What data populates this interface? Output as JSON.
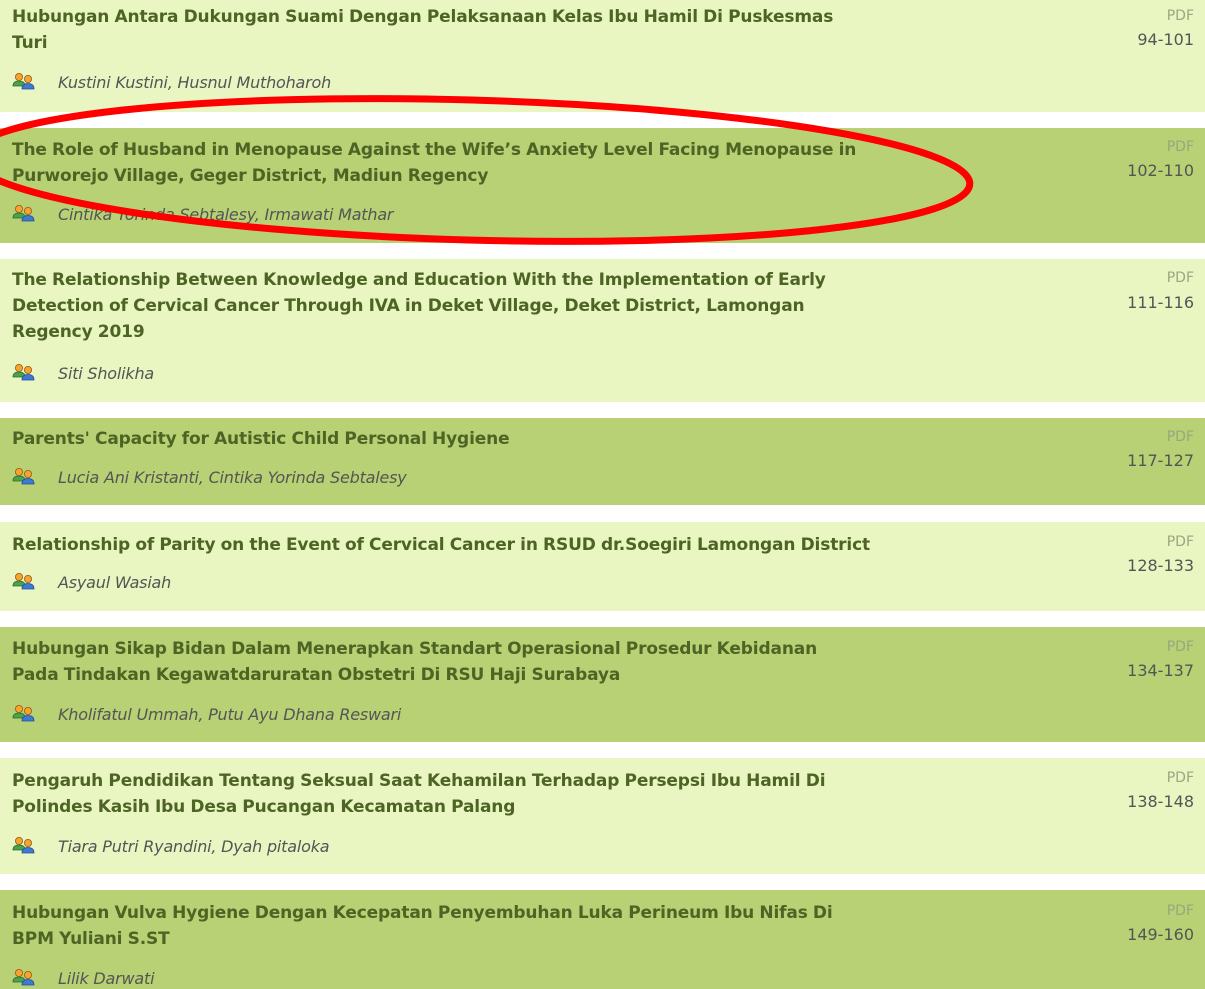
{
  "articles": [
    {
      "title_lines": [
        "Hubungan Antara Dukungan Suami Dengan Pelaksanaan Kelas Ibu Hamil Di Puskesmas",
        "Turi"
      ],
      "authors": "Kustini Kustini, Husnul Muthoharoh",
      "galley": "PDF",
      "pages": "94-101",
      "style": "light"
    },
    {
      "title_lines": [
        "The Role of Husband in Menopause Against the Wife’s Anxiety Level Facing Menopause in",
        "Purworejo Village, Geger District, Madiun Regency"
      ],
      "authors": "Cintika Yorinda Sebtalesy, Irmawati Mathar",
      "galley": "PDF",
      "pages": "102-110",
      "style": "dark"
    },
    {
      "title_lines": [
        "The Relationship Between Knowledge and Education With the Implementation of Early",
        "Detection of Cervical Cancer Through IVA in Deket Village, Deket District, Lamongan",
        "Regency 2019"
      ],
      "authors": "Siti Sholikha",
      "galley": "PDF",
      "pages": "111-116",
      "style": "light"
    },
    {
      "title_lines": [
        "Parents' Capacity for Autistic Child Personal Hygiene"
      ],
      "authors": "Lucia Ani Kristanti, Cintika Yorinda Sebtalesy",
      "galley": "PDF",
      "pages": "117-127",
      "style": "dark"
    },
    {
      "title_lines": [
        "Relationship of Parity on the Event of Cervical Cancer in RSUD dr.Soegiri Lamongan District"
      ],
      "authors": "Asyaul Wasiah",
      "galley": "PDF",
      "pages": "128-133",
      "style": "light"
    },
    {
      "title_lines": [
        "Hubungan Sikap Bidan Dalam Menerapkan Standart Operasional Prosedur Kebidanan",
        "Pada Tindakan Kegawatdaruratan Obstetri Di RSU Haji Surabaya"
      ],
      "authors": "Kholifatul Ummah, Putu Ayu Dhana Reswari",
      "galley": "PDF",
      "pages": "134-137",
      "style": "dark"
    },
    {
      "title_lines": [
        "Pengaruh Pendidikan Tentang Seksual Saat Kehamilan Terhadap Persepsi Ibu Hamil Di",
        "Polindes Kasih Ibu Desa Pucangan Kecamatan Palang"
      ],
      "authors": "Tiara Putri Ryandini, Dyah pitaloka",
      "galley": "PDF",
      "pages": "138-148",
      "style": "light"
    },
    {
      "title_lines": [
        "Hubungan Vulva Hygiene Dengan Kecepatan Penyembuhan Luka Perineum Ibu Nifas Di",
        "BPM Yuliani S.ST"
      ],
      "authors": "Lilik Darwati",
      "galley": "PDF",
      "pages": "149-160",
      "style": "dark"
    }
  ],
  "icons": {
    "authors": "users-icon"
  },
  "colors": {
    "row_light": "#e9f6c2",
    "row_dark": "#b7d174",
    "title": "#4d6424",
    "highlight": "#ff0000"
  }
}
